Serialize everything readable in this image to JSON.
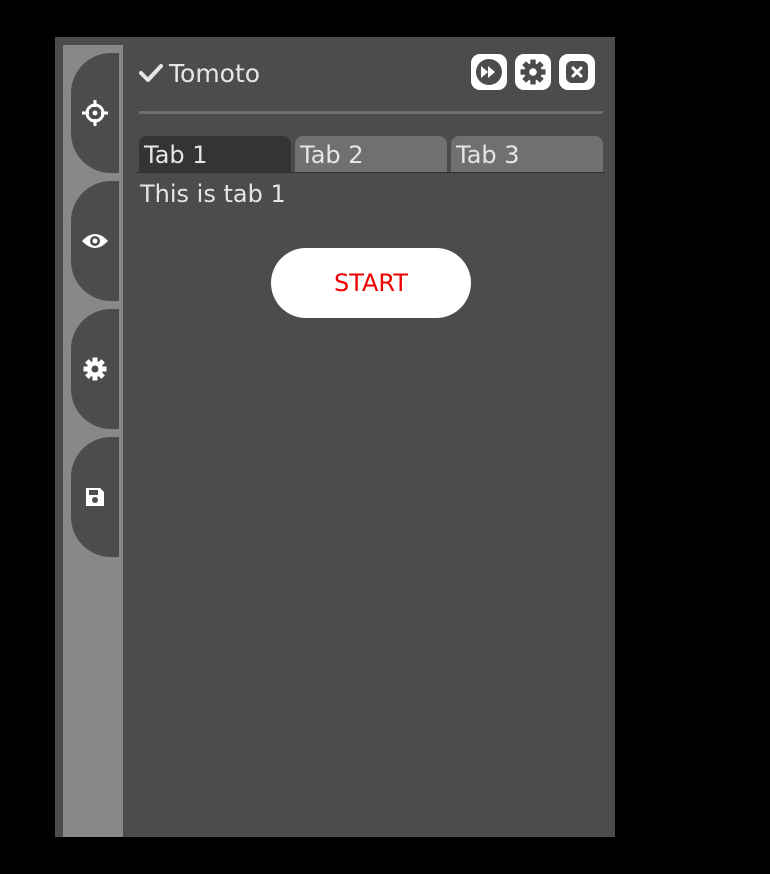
{
  "app": {
    "title": "Tomoto"
  },
  "header": {
    "buttons": [
      {
        "icon": "fast-forward-icon"
      },
      {
        "icon": "gear-icon"
      },
      {
        "icon": "close-icon"
      }
    ]
  },
  "sidebar": {
    "items": [
      {
        "icon": "crosshair-icon"
      },
      {
        "icon": "eye-icon"
      },
      {
        "icon": "gear-icon"
      },
      {
        "icon": "save-icon"
      }
    ]
  },
  "tabs": [
    {
      "label": "Tab 1",
      "active": true
    },
    {
      "label": "Tab 2",
      "active": false
    },
    {
      "label": "Tab 3",
      "active": false
    }
  ],
  "content": {
    "text": "This is tab 1",
    "start_label": "START"
  },
  "colors": {
    "background": "#000000",
    "panel": "#4c4c4c",
    "side_strip": "#888888",
    "tab_active": "#343434",
    "tab_inactive": "#707070",
    "start_text": "#ee0000"
  }
}
